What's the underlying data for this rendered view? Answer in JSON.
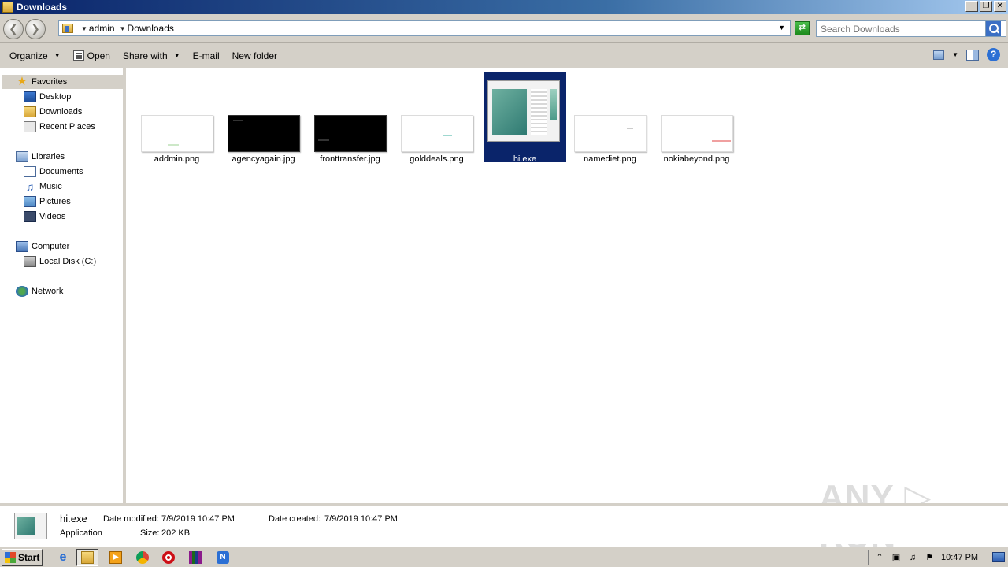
{
  "window": {
    "title": "Downloads",
    "controls": [
      "_",
      "❐",
      "✕"
    ]
  },
  "address": {
    "crumbs": [
      "admin",
      "Downloads"
    ],
    "search_placeholder": "Search Downloads"
  },
  "commands": {
    "organize": "Organize",
    "open": "Open",
    "share_with": "Share with",
    "email": "E-mail",
    "new_folder": "New folder"
  },
  "nav": {
    "favorites": "Favorites",
    "desktop": "Desktop",
    "downloads": "Downloads",
    "recent_places": "Recent Places",
    "libraries": "Libraries",
    "documents": "Documents",
    "music": "Music",
    "pictures": "Pictures",
    "videos": "Videos",
    "computer": "Computer",
    "local_disk": "Local Disk (C:)",
    "network": "Network"
  },
  "files": [
    {
      "name": "addmin.png",
      "thumb": "white"
    },
    {
      "name": "agencyagain.jpg",
      "thumb": "black"
    },
    {
      "name": "fronttransfer.jpg",
      "thumb": "black"
    },
    {
      "name": "golddeals.png",
      "thumb": "white"
    },
    {
      "name": "hi.exe",
      "thumb": "app",
      "selected": true
    },
    {
      "name": "namediet.png",
      "thumb": "white"
    },
    {
      "name": "nokiabeyond.png",
      "thumb": "white"
    }
  ],
  "details": {
    "name": "hi.exe",
    "type": "Application",
    "date_modified_label": "Date modified:",
    "date_modified": "7/9/2019 10:47 PM",
    "size_label": "Size:",
    "size": "202 KB",
    "date_created_label": "Date created:",
    "date_created": "7/9/2019 10:47 PM"
  },
  "watermark": "ANY ▷ RUN",
  "taskbar": {
    "start": "Start",
    "clock": "10:47 PM"
  },
  "colors": {
    "selection": "#0a246a",
    "chrome": "#d4d0c8"
  }
}
